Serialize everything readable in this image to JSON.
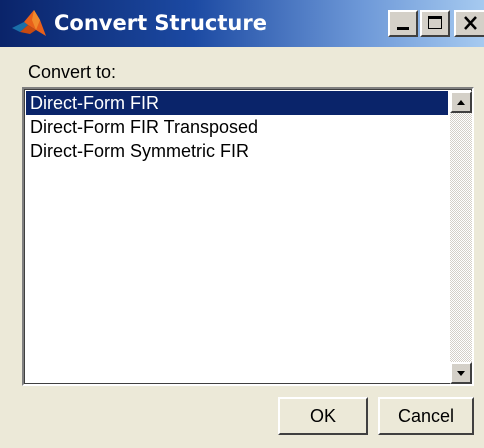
{
  "window": {
    "title": "Convert Structure",
    "title_gradient": [
      "#0a246a",
      "#a6caf0"
    ],
    "controls": {
      "minimize_icon": "minimize-icon",
      "maximize_icon": "maximize-icon",
      "close_icon": "close-icon"
    }
  },
  "app_icon": "matlab-logo-icon",
  "form": {
    "label": "Convert to:",
    "options": [
      "Direct-Form FIR",
      "Direct-Form FIR Transposed",
      "Direct-Form Symmetric FIR"
    ],
    "selected_index": 0,
    "selection_color": "#0a246a"
  },
  "scrollbar": {
    "up_icon": "arrow-up-icon",
    "down_icon": "arrow-down-icon"
  },
  "buttons": {
    "ok": "OK",
    "cancel": "Cancel"
  }
}
